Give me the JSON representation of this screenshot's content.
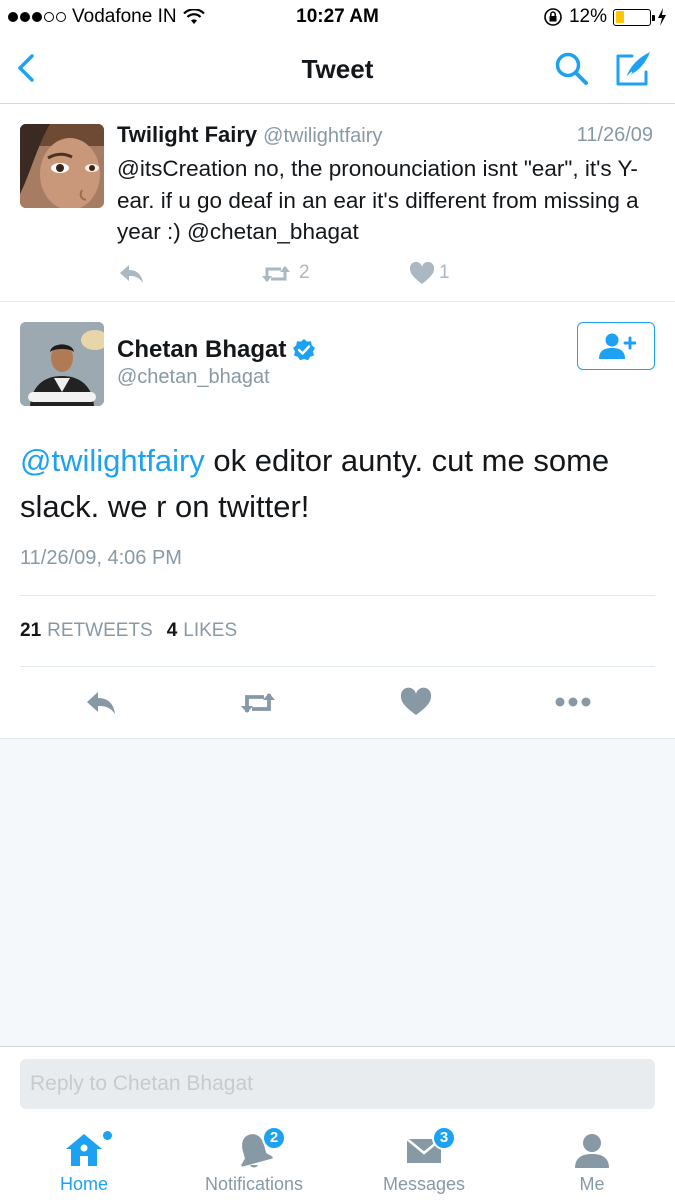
{
  "status_bar": {
    "carrier": "Vodafone IN",
    "time": "10:27 AM",
    "battery": "12%",
    "signal_bars": 3
  },
  "nav": {
    "title": "Tweet"
  },
  "parent_tweet": {
    "name": "Twilight Fairy",
    "handle": "@twilightfairy",
    "date": "11/26/09",
    "text": "@itsCreation no, the pronounciation isnt \"ear\", it's Y-ear. if u go deaf in an ear it's different from missing a year :) @chetan_bhagat",
    "retweets": "2",
    "likes": "1"
  },
  "main_tweet": {
    "name": "Chetan Bhagat",
    "handle": "@chetan_bhagat",
    "mention": "@twilightfairy",
    "text": " ok editor aunty. cut me some slack. we r on twitter!",
    "timestamp": "11/26/09, 4:06 PM",
    "retweet_count": "21",
    "retweet_label": "RETWEETS",
    "like_count": "4",
    "like_label": "LIKES"
  },
  "reply": {
    "placeholder": "Reply to Chetan Bhagat"
  },
  "tabs": [
    {
      "label": "Home",
      "icon": "home-icon",
      "active": true
    },
    {
      "label": "Notifications",
      "icon": "bell-icon",
      "badge": "2"
    },
    {
      "label": "Messages",
      "icon": "envelope-icon",
      "badge": "3"
    },
    {
      "label": "Me",
      "icon": "person-icon"
    }
  ],
  "colors": {
    "accent": "#1da1f2",
    "muted": "#8899a6",
    "icon_gray": "#8899a6",
    "battery_low": "#ffc700"
  }
}
